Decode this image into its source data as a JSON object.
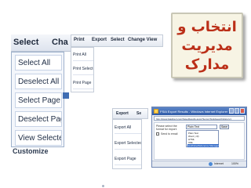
{
  "title_banner": {
    "lines": [
      "انتخاب و",
      "مدیریت",
      "مدارک"
    ],
    "color": "#bb2f18"
  },
  "select_panel": {
    "menu_bar": [
      "Select",
      "Cha"
    ],
    "items": [
      "Select All",
      "Deselect All",
      "Select Page",
      "Deselect Page",
      "View Selected"
    ],
    "below_fragment": "Customize"
  },
  "print_panel": {
    "menu_bar": [
      "Print",
      "Export",
      "Select",
      "Change View"
    ],
    "items": [
      "Print All",
      "Print Selected",
      "Print Page"
    ]
  },
  "export_panel": {
    "menu_bar": [
      "Export",
      "Se"
    ],
    "items": [
      "Export All",
      "Export Selected",
      "Export Page"
    ]
  },
  "ie_dialog": {
    "title": "FSIA Export Results - Windows Internet Explorer",
    "address": "http://www.fsiadirect.com/SaveResults.aspx?items=SL&dsearchHistory1",
    "prompt": "Please select the format for export:",
    "format_selected": "Plain Text",
    "save_label": "Save",
    "checkbox_label": "Send to email",
    "format_options": [
      "Plain Text",
      "Word (.rtf)",
      "HTML",
      "XML",
      "EndNote/Reference Manager/ProCite"
    ],
    "selected_option_index": 4,
    "status_zone": "Internet",
    "zoom": "100%"
  }
}
